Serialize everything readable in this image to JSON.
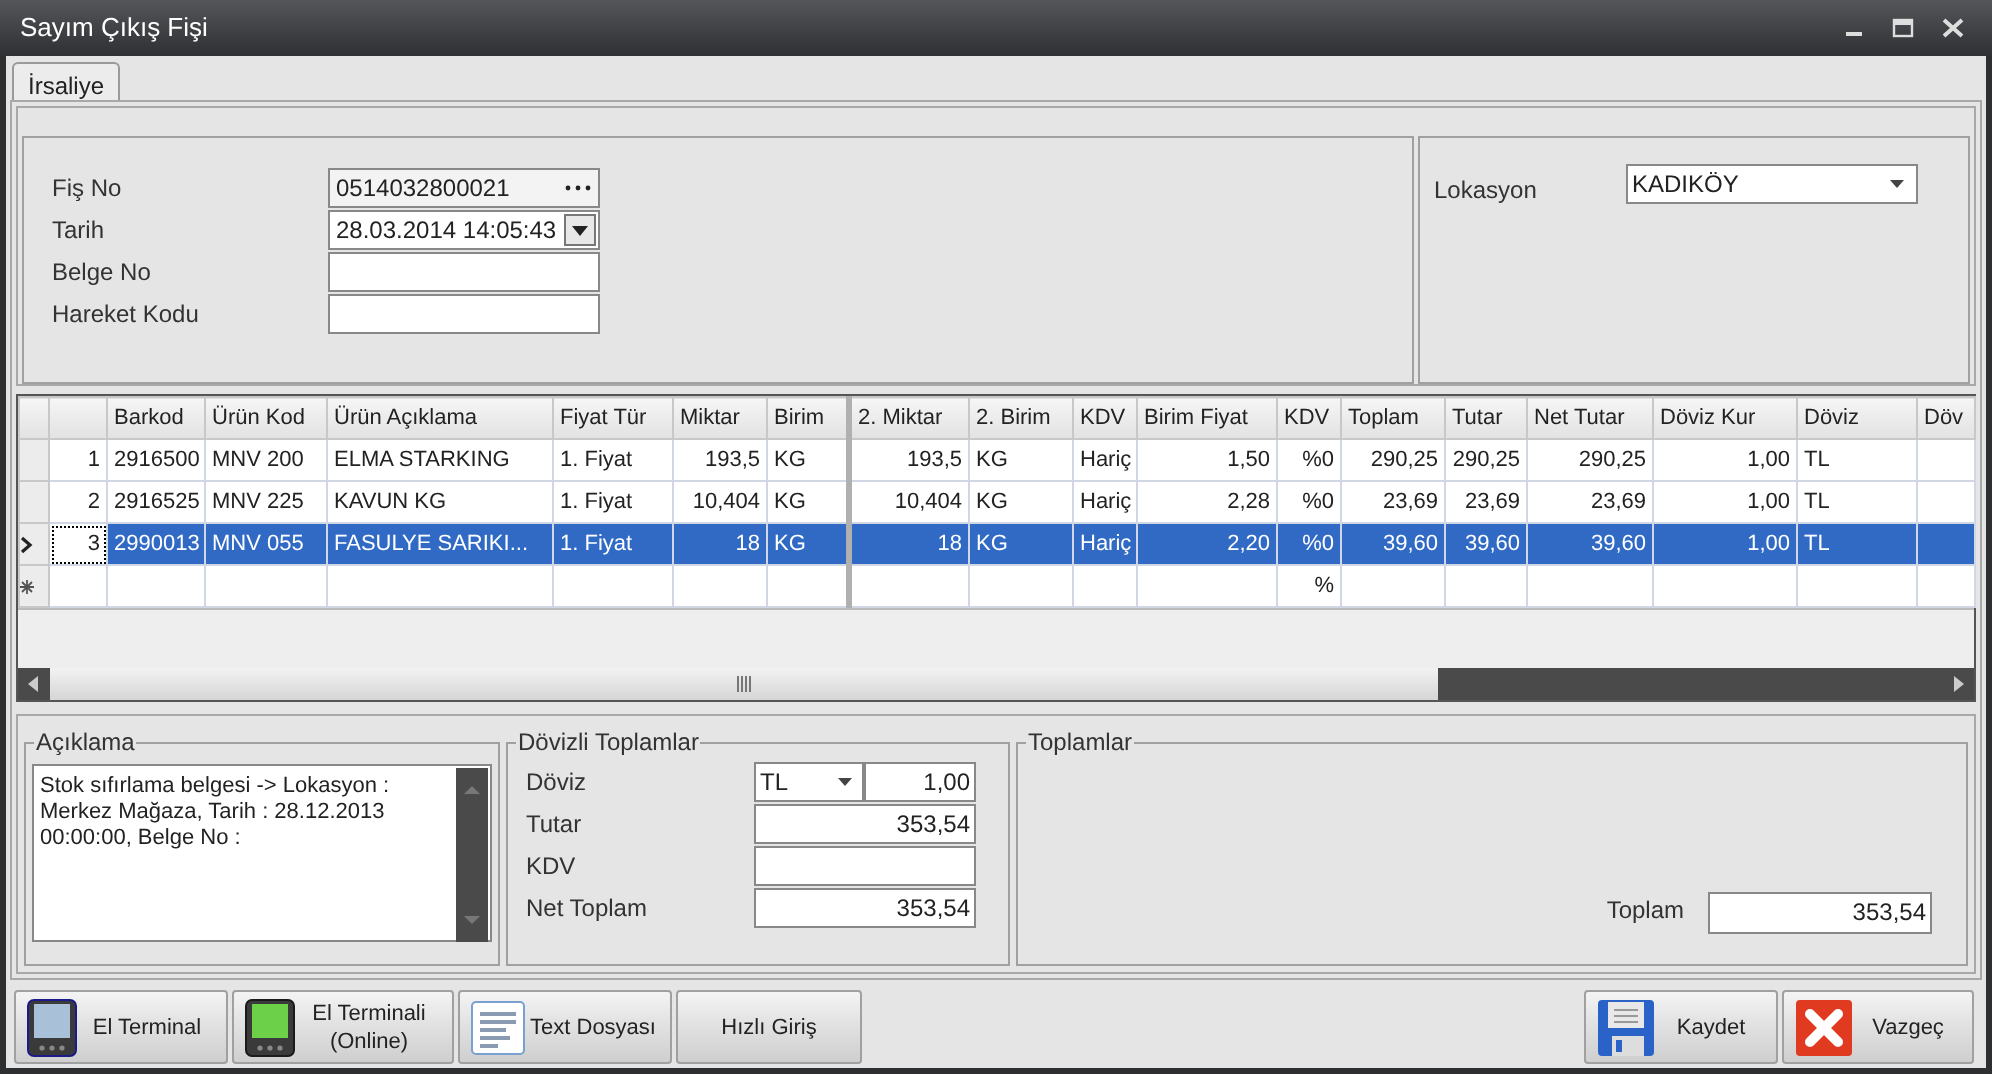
{
  "window": {
    "title": "Sayım Çıkış Fişi"
  },
  "tabs": [
    {
      "label": "İrsaliye",
      "selected": true
    }
  ],
  "header": {
    "fields": [
      {
        "label": "Fiş No",
        "value": "0514032800021",
        "kind": "lookup"
      },
      {
        "label": "Tarih",
        "value": "28.03.2014 14:05:43",
        "kind": "date"
      },
      {
        "label": "Belge No",
        "kind": "text"
      },
      {
        "label": "Hareket Kodu",
        "kind": "text"
      }
    ],
    "location": {
      "label": "Lokasyon",
      "value": "KADIKÖY"
    }
  },
  "grid": {
    "columns": [
      {},
      {
        "label": "Barkod"
      },
      {
        "label": "Ürün Kod"
      },
      {
        "label": "Ürün Açıklama"
      },
      {
        "label": "Fiyat Tür"
      },
      {
        "label": "Miktar"
      },
      {
        "label": "Birim"
      },
      {
        "label": "2. Miktar"
      },
      {
        "label": "2. Birim"
      },
      {
        "label": "KDV"
      },
      {
        "label": "Birim Fiyat"
      },
      {
        "label": "KDV"
      },
      {
        "label": "Toplam"
      },
      {
        "label": "Tutar"
      },
      {
        "label": "Net Tutar"
      },
      {
        "label": "Döviz Kur"
      },
      {
        "label": "Döviz"
      },
      {
        "label": "Döv"
      }
    ],
    "rows": [
      {
        "current": false,
        "selected": false,
        "cells": [
          "1",
          "2916500",
          "MNV 200",
          "ELMA STARKING",
          "1. Fiyat",
          "193,5",
          "KG",
          "193,5",
          "KG",
          "Hariç",
          "1,50",
          "%0",
          "290,25",
          "290,25",
          "290,25",
          "1,00",
          "TL",
          null
        ]
      },
      {
        "current": false,
        "selected": false,
        "cells": [
          "2",
          "2916525",
          "MNV 225",
          "KAVUN  KG",
          "1. Fiyat",
          "10,404",
          "KG",
          "10,404",
          "KG",
          "Hariç",
          "2,28",
          "%0",
          "23,69",
          "23,69",
          "23,69",
          "1,00",
          "TL",
          null
        ]
      },
      {
        "current": true,
        "selected": true,
        "cells": [
          "3",
          "2990013",
          "MNV 055",
          "FASULYE SARIKI...",
          "1. Fiyat",
          "18",
          "KG",
          "18",
          "KG",
          "Hariç",
          "2,20",
          "%0",
          "39,60",
          "39,60",
          "39,60",
          "1,00",
          "TL",
          null
        ]
      }
    ],
    "new_row": {
      "cells": [
        null,
        null,
        null,
        null,
        null,
        null,
        null,
        null,
        null,
        null,
        null,
        "%",
        null,
        null,
        null,
        null,
        null,
        null
      ]
    }
  },
  "notes": {
    "title": "Açıklama",
    "text": "Stok sıfırlama belgesi -> Lokasyon : Merkez Mağaza, Tarih : 28.12.2013 00:00:00, Belge No :"
  },
  "currency_totals": {
    "title": "Dövizli Toplamlar",
    "currency_label": "Döviz",
    "currency": "TL",
    "rate": "1,00",
    "fields": [
      {
        "label": "Tutar",
        "value": "353,54"
      },
      {
        "label": "KDV"
      },
      {
        "label": "Net Toplam",
        "value": "353,54"
      }
    ]
  },
  "totals": {
    "title": "Toplamlar",
    "label": "Toplam",
    "value": "353,54"
  },
  "left_buttons": [
    {
      "label": "El Terminal",
      "kind": "terminal"
    },
    {
      "label": "El Terminali (Online)",
      "kind": "terminal_online"
    },
    {
      "label": "Text Dosyası",
      "kind": "text_file"
    },
    {
      "label": "Hızlı Giriş",
      "kind": "plain"
    }
  ],
  "right_buttons": [
    {
      "label": "Kaydet",
      "kind": "save"
    },
    {
      "label": "Vazgeç",
      "kind": "cancel"
    }
  ]
}
